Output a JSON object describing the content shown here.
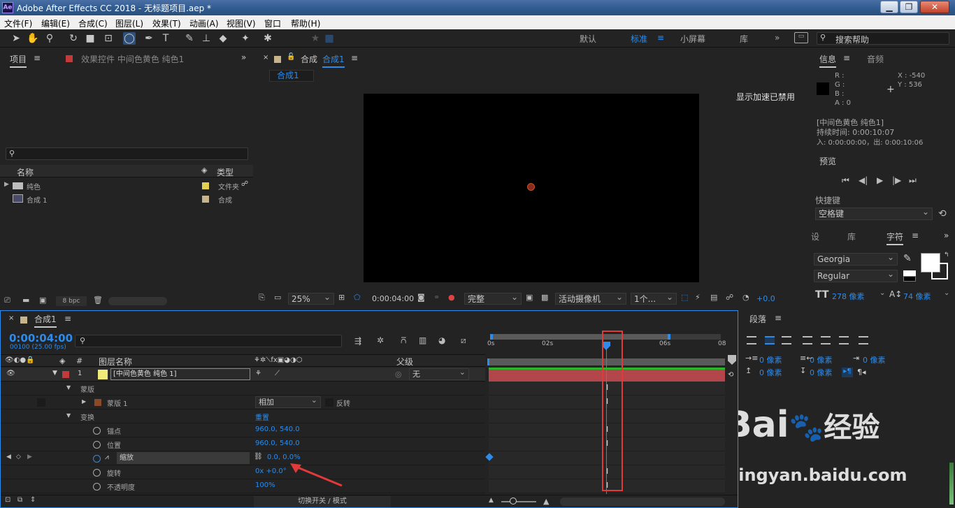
{
  "window": {
    "app_icon": "Ae",
    "title": "Adobe After Effects CC 2018 - 无标题项目.aep *",
    "min": "▁",
    "max": "❐",
    "close": "✕"
  },
  "menu": [
    "文件(F)",
    "编辑(E)",
    "合成(C)",
    "图层(L)",
    "效果(T)",
    "动画(A)",
    "视图(V)",
    "窗口",
    "帮助(H)"
  ],
  "workspaces": {
    "default": "默认",
    "standard": "标准",
    "small": "小屏幕",
    "library": "库",
    "more": "»"
  },
  "search_help": {
    "placeholder": "搜索帮助"
  },
  "project_panel": {
    "tab": "项目",
    "effects_tab": "效果控件 中间色黄色 纯色1",
    "col_name": "名称",
    "col_type": "类型",
    "items": [
      {
        "name": "纯色",
        "type": "文件夹",
        "color": "#e2d04e"
      },
      {
        "name": "合成 1",
        "type": "合成",
        "color": "#c8b48a"
      }
    ],
    "bpc": "8 bpc"
  },
  "composition_panel": {
    "tab_prefix": "合成",
    "tab_name": "合成1",
    "breadcrumb": "合成1",
    "accel_notice": "显示加速已禁用",
    "zoom": "25%",
    "timecode": "0:00:04:00",
    "resolution": "完整",
    "camera": "活动摄像机",
    "views": "1个...",
    "exposure": "+0.0"
  },
  "info_panel": {
    "tab": "信息",
    "audio_tab": "音频",
    "r": "R :",
    "g": "G :",
    "b": "B :",
    "a": "A : 0",
    "x": "X : -540",
    "y": "Y : 536",
    "layer": "[中间色黄色 纯色1]",
    "duration": "持续时间: 0:00:10:07",
    "inout": "入: 0:00:00:00，出: 0:00:10:06"
  },
  "preview_panel": {
    "tab": "预览",
    "shortcut_label": "快捷键",
    "shortcut": "空格键"
  },
  "char_panel": {
    "tab_set": "设",
    "tab_lib": "库",
    "tab_char": "字符",
    "font": "Georgia",
    "style": "Regular",
    "size": "278 像素",
    "leading": "74 像素"
  },
  "para_panel": {
    "tab": "段落",
    "px": "0 像素"
  },
  "timeline": {
    "tab": "合成1",
    "timecode": "0:00:04:00",
    "frames": "00100 (25.00 fps)",
    "col_hash": "#",
    "col_layer": "图层名称",
    "col_parent": "父级",
    "ruler": [
      "0s",
      "02s",
      "",
      "06s",
      "08"
    ],
    "layer": {
      "num": "1",
      "name": "[中间色黄色 纯色 1]",
      "parent": "无"
    },
    "rows": {
      "masks": "蒙版",
      "mask1": "蒙版 1",
      "mask_mode": "相加",
      "invert": "反转",
      "transform": "变换",
      "reset": "重置",
      "anchor": "锚点",
      "anchor_val": "960.0, 540.0",
      "position": "位置",
      "position_val": "960.0, 540.0",
      "scale": "缩放",
      "scale_val": "0.0, 0.0%",
      "rotation": "旋转",
      "rotation_val": "0x +0.0°",
      "opacity": "不透明度",
      "opacity_val": "100%"
    },
    "footer": "切换开关 / 模式"
  },
  "watermark": {
    "brand": "Bai",
    "brand2": "经验",
    "url": "jingyan.baidu.com"
  },
  "colors": {
    "accent": "#2d8ceb",
    "layer_bar": "#b3464a",
    "highlight_box": "#e03a3a"
  }
}
